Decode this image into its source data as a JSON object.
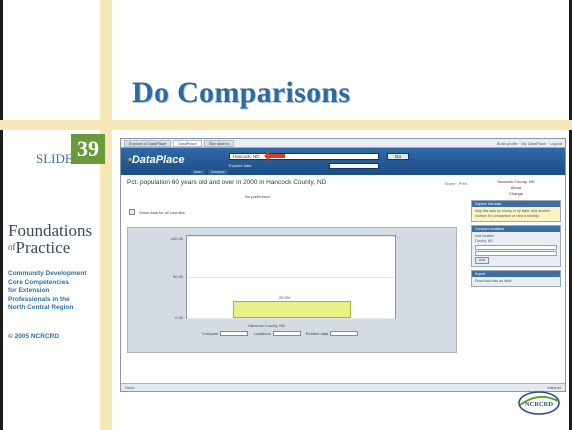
{
  "slide": {
    "title": "Do Comparisons",
    "slide_label": "SLIDE",
    "slide_number": "39",
    "brand_line1": "Foundations",
    "brand_amp": "of",
    "brand_line2": "Practice",
    "subtitle_lines": [
      "Community Development",
      "Core Competencies",
      "for Extension",
      "Professionals in the",
      "North Central Region"
    ],
    "copyright": "© 2005 NCRCRD",
    "logo_text": "NCRCRD",
    "colors": {
      "frame_bar": "#f7e6b6",
      "title": "#2c6aa6",
      "number_box": "#6b9a3b",
      "text_blue": "#2f6fa7"
    }
  },
  "screenshot": {
    "browser_tabs": [
      "Explore in DataPlace",
      "DataPlace",
      "Site search"
    ],
    "tabs_right": "Build profile · My DataPlace · Logout",
    "app_logo": "DataPlace",
    "search_value": "Hancock, ND",
    "go_label": "Go",
    "search_hint": "Explore data",
    "subnav": [
      "Main",
      "Compare"
    ],
    "result_title": "Pct. population 60 years old and over in 2000 in Hancock County, ND",
    "result_tools": "Share · Print",
    "chart": {
      "title": "No preference",
      "checkbox_label": "Show data for all counties",
      "y_ticks": [
        "100.00",
        "50.00",
        "0.00"
      ],
      "bar_label": "20.3%",
      "x_label": "Hancock County, ND",
      "legend": [
        "Compare",
        "Locations",
        "Related data"
      ]
    },
    "sidebar": {
      "info": "Hancock County, ND\nAbout\nChange",
      "boxes": [
        {
          "head": "Explore this data",
          "body": "Map this data by county or by state. Add another location for comparison or view a ranking."
        },
        {
          "head": "Compare locations",
          "body": "Add location\nCounty, ND"
        },
        {
          "head": "Export",
          "body": "Download data as table"
        }
      ],
      "add_button": "Add"
    },
    "status_left": "Done",
    "status_right": "Internet"
  },
  "chart_data": {
    "type": "bar",
    "title": "No preference",
    "categories": [
      "Hancock County, ND"
    ],
    "values": [
      20.3
    ],
    "xlabel": "Hancock County, ND",
    "ylabel": "",
    "ylim": [
      0,
      100
    ],
    "grid": true
  }
}
